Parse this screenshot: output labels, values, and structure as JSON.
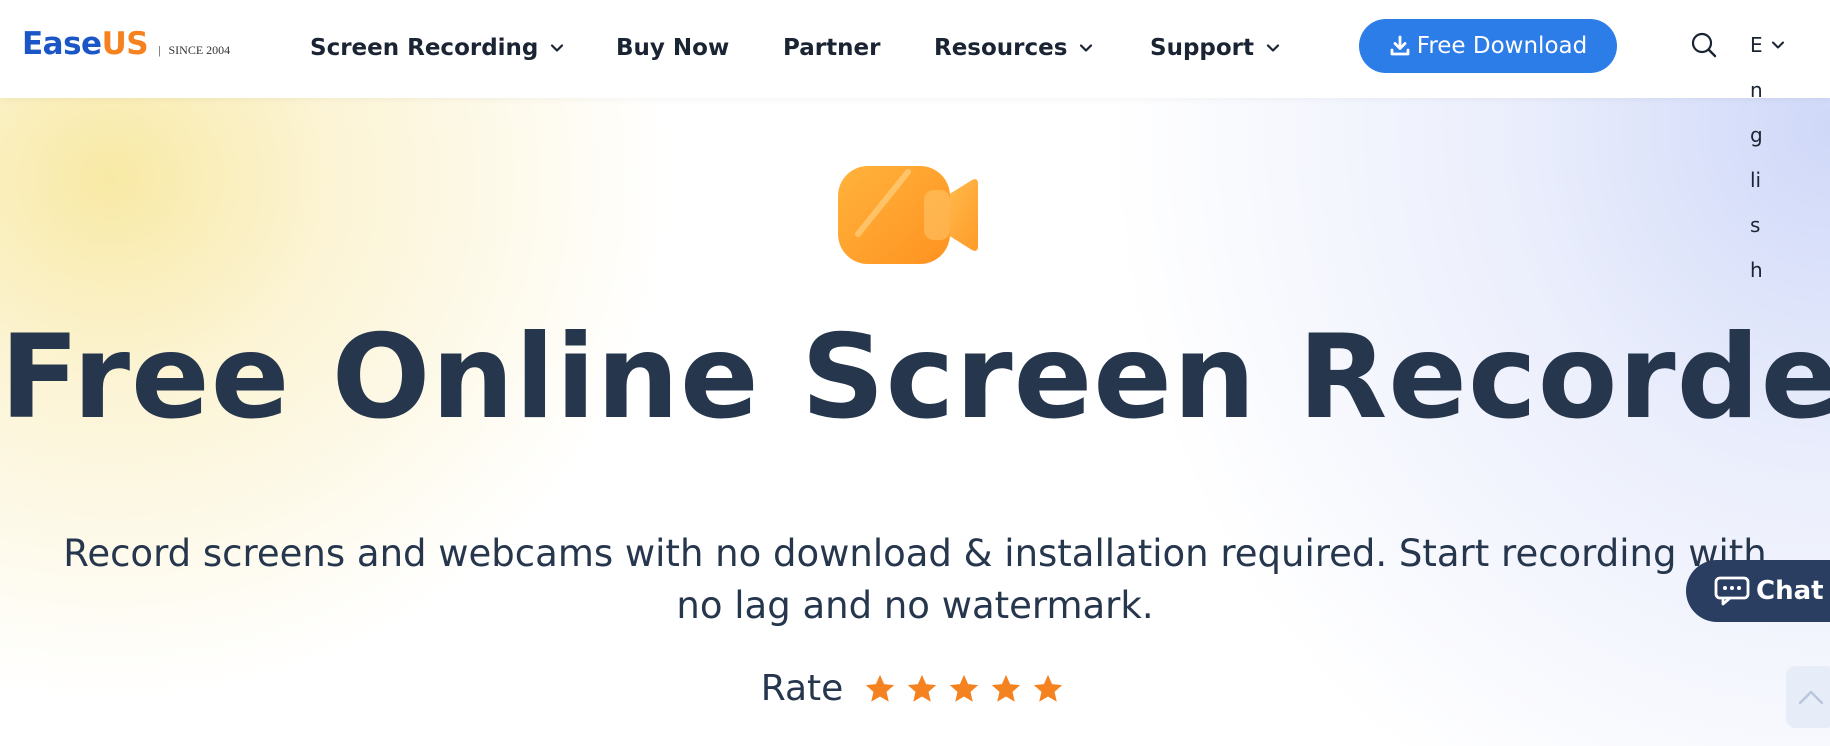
{
  "logo": {
    "part1": "Ease",
    "part2": "US",
    "separator": "|",
    "tagline": "SINCE 2004"
  },
  "nav": {
    "items": [
      {
        "label": "Screen Recording",
        "has_dropdown": true
      },
      {
        "label": "Buy Now",
        "has_dropdown": false
      },
      {
        "label": "Partner",
        "has_dropdown": false
      },
      {
        "label": "Resources",
        "has_dropdown": true
      },
      {
        "label": "Support",
        "has_dropdown": true
      }
    ],
    "download_button": {
      "label": "Free Download",
      "icon": "download-icon"
    },
    "search_icon": "search-icon",
    "language": {
      "first": "E",
      "rest": [
        "n",
        "g",
        "li",
        "s",
        "h"
      ]
    }
  },
  "hero": {
    "icon": "video-camera-icon",
    "title": "Free Online Screen Recorder",
    "subtitle_line1": "Record screens and webcams with no download & installation required. Start recording with",
    "subtitle_line2": "no lag and no watermark.",
    "rate_label": "Rate",
    "stars": 5
  },
  "chat": {
    "label": "Chat",
    "icon": "chat-bubble-icon"
  },
  "back_to_top": {
    "icon": "chevron-up-icon"
  },
  "colors": {
    "brand_blue": "#1a56c5",
    "brand_orange": "#f5821f",
    "button_blue": "#2d7de8",
    "title_navy": "#26364d",
    "star_orange": "#f58220",
    "chat_navy": "#2a3e62"
  }
}
